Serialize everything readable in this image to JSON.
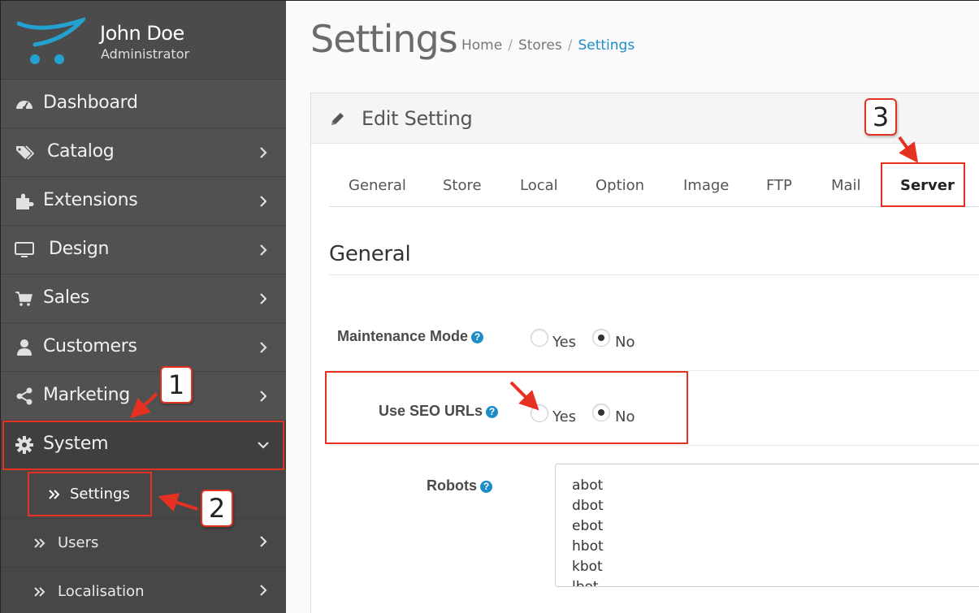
{
  "profile": {
    "name": "John Doe",
    "role": "Administrator"
  },
  "sidebar": {
    "items": [
      {
        "label": "Dashboard",
        "icon": "dashboard-icon"
      },
      {
        "label": "Catalog",
        "icon": "tags-icon"
      },
      {
        "label": "Extensions",
        "icon": "puzzle-icon"
      },
      {
        "label": "Design",
        "icon": "monitor-icon"
      },
      {
        "label": "Sales",
        "icon": "cart-icon"
      },
      {
        "label": "Customers",
        "icon": "user-icon"
      },
      {
        "label": "Marketing",
        "icon": "share-icon"
      },
      {
        "label": "System",
        "icon": "gear-icon"
      }
    ],
    "sub_items": [
      {
        "label": "Settings"
      },
      {
        "label": "Users"
      },
      {
        "label": "Localisation"
      }
    ]
  },
  "header": {
    "title": "Settings",
    "breadcrumb": [
      "Home",
      "Stores",
      "Settings"
    ]
  },
  "panel": {
    "title": "Edit Setting",
    "tabs": [
      "General",
      "Store",
      "Local",
      "Option",
      "Image",
      "FTP",
      "Mail",
      "Server"
    ],
    "active_tab": "Server",
    "legend": "General",
    "fields": {
      "maintenance": {
        "label": "Maintenance Mode",
        "yes": "Yes",
        "no": "No",
        "selected": "No"
      },
      "seo": {
        "label": "Use SEO URLs",
        "yes": "Yes",
        "no": "No",
        "selected": "No"
      },
      "robots": {
        "label": "Robots",
        "lines": [
          "abot",
          "dbot",
          "ebot",
          "hbot",
          "kbot",
          "lbot"
        ]
      }
    },
    "help_glyph": "?"
  },
  "annotations": {
    "badge_1": "1",
    "badge_2": "2",
    "badge_3": "3"
  },
  "colors": {
    "accent": "#1e8dc7",
    "annotation": "#e53121",
    "sidebar": "#515151"
  }
}
